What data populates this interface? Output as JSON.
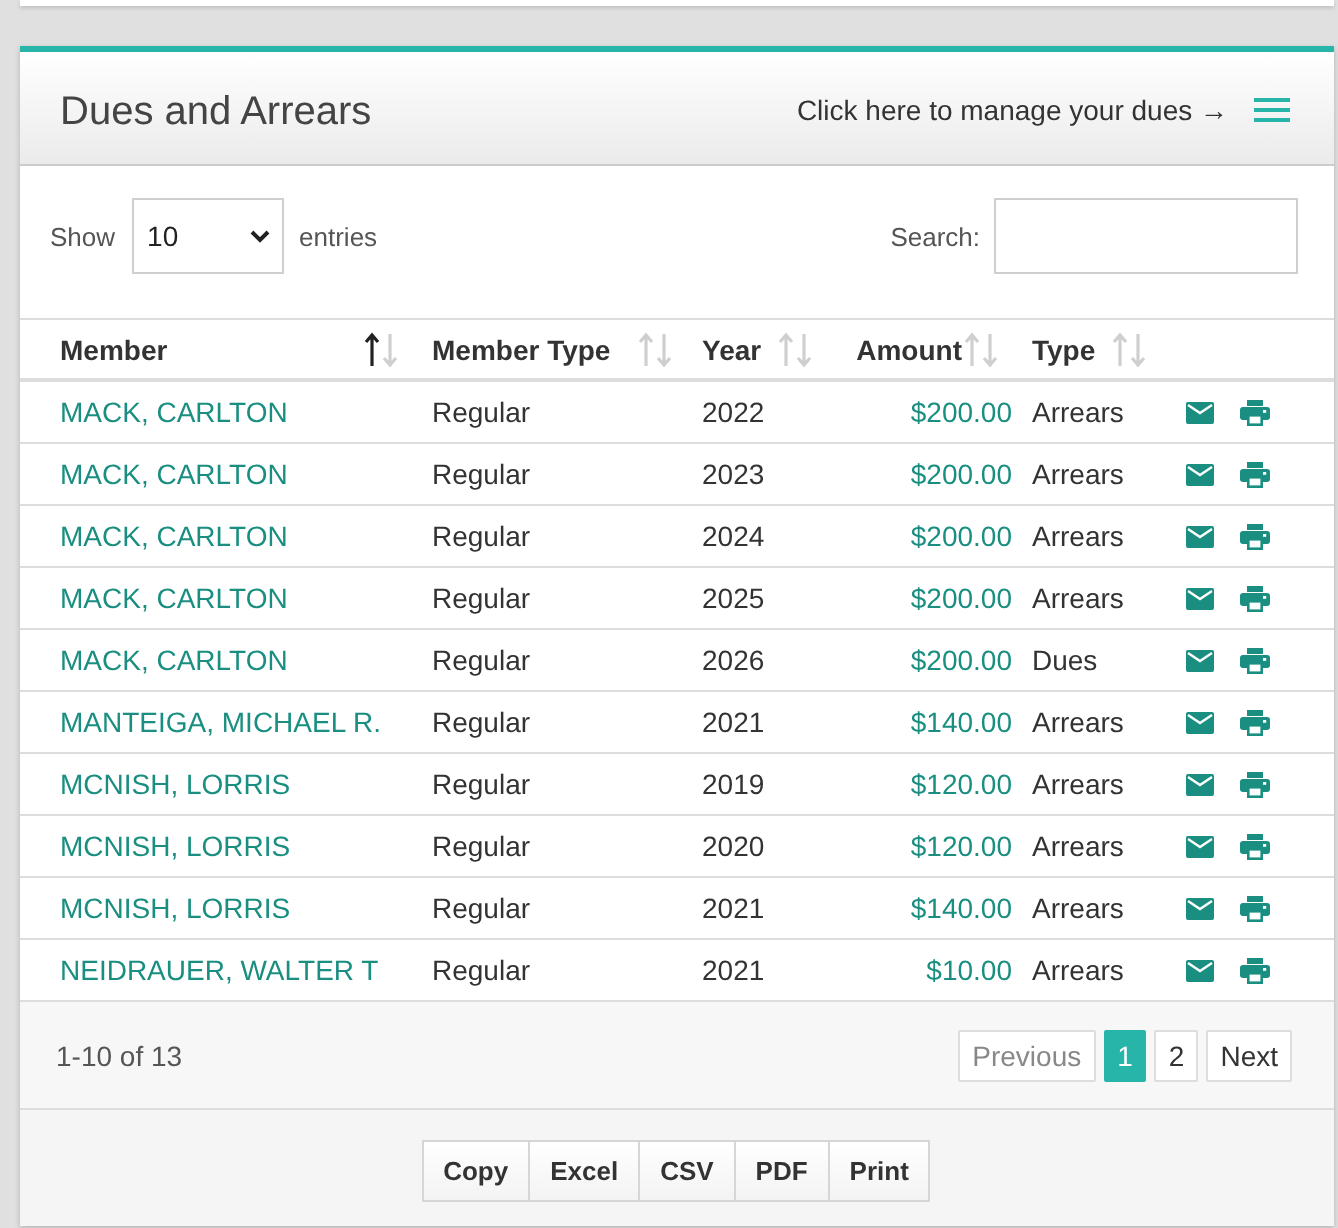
{
  "panel": {
    "title": "Dues and Arrears",
    "manage_link": "Click here to manage your dues →"
  },
  "length_control": {
    "label_before": "Show",
    "value": "10",
    "label_after": "entries"
  },
  "search": {
    "label": "Search:"
  },
  "table": {
    "columns": [
      {
        "label": "Member",
        "sorted": true
      },
      {
        "label": "Member Type",
        "sorted": false
      },
      {
        "label": "Year",
        "sorted": false
      },
      {
        "label": "Amount",
        "sorted": false
      },
      {
        "label": "Type",
        "sorted": false
      }
    ],
    "rows": [
      {
        "member": "MACK, CARLTON",
        "member_type": "Regular",
        "year": "2022",
        "amount": "$200.00",
        "type": "Arrears"
      },
      {
        "member": "MACK, CARLTON",
        "member_type": "Regular",
        "year": "2023",
        "amount": "$200.00",
        "type": "Arrears"
      },
      {
        "member": "MACK, CARLTON",
        "member_type": "Regular",
        "year": "2024",
        "amount": "$200.00",
        "type": "Arrears"
      },
      {
        "member": "MACK, CARLTON",
        "member_type": "Regular",
        "year": "2025",
        "amount": "$200.00",
        "type": "Arrears"
      },
      {
        "member": "MACK, CARLTON",
        "member_type": "Regular",
        "year": "2026",
        "amount": "$200.00",
        "type": "Dues"
      },
      {
        "member": "MANTEIGA, MICHAEL R.",
        "member_type": "Regular",
        "year": "2021",
        "amount": "$140.00",
        "type": "Arrears"
      },
      {
        "member": "MCNISH, LORRIS",
        "member_type": "Regular",
        "year": "2019",
        "amount": "$120.00",
        "type": "Arrears"
      },
      {
        "member": "MCNISH, LORRIS",
        "member_type": "Regular",
        "year": "2020",
        "amount": "$120.00",
        "type": "Arrears"
      },
      {
        "member": "MCNISH, LORRIS",
        "member_type": "Regular",
        "year": "2021",
        "amount": "$140.00",
        "type": "Arrears"
      },
      {
        "member": "NEIDRAUER, WALTER T",
        "member_type": "Regular",
        "year": "2021",
        "amount": "$10.00",
        "type": "Arrears"
      }
    ]
  },
  "info": "1-10 of 13",
  "pagination": {
    "previous": {
      "label": "Previous",
      "disabled": true
    },
    "pages": [
      {
        "label": "1",
        "selected": true
      },
      {
        "label": "2",
        "selected": false
      }
    ],
    "next": {
      "label": "Next",
      "disabled": false
    }
  },
  "export_buttons": [
    "Copy",
    "Excel",
    "CSV",
    "PDF",
    "Print"
  ]
}
